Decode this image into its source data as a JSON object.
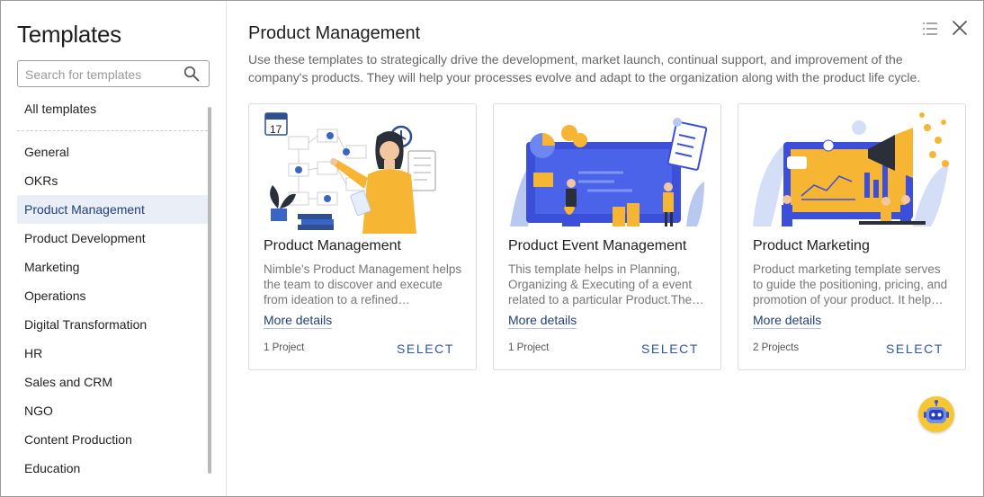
{
  "sidebar": {
    "title": "Templates",
    "search_placeholder": "Search for templates",
    "all_templates": "All templates",
    "items": [
      {
        "label": "General",
        "active": false
      },
      {
        "label": "OKRs",
        "active": false
      },
      {
        "label": "Product Management",
        "active": true
      },
      {
        "label": "Product Development",
        "active": false
      },
      {
        "label": "Marketing",
        "active": false
      },
      {
        "label": "Operations",
        "active": false
      },
      {
        "label": "Digital Transformation",
        "active": false
      },
      {
        "label": "HR",
        "active": false
      },
      {
        "label": "Sales and CRM",
        "active": false
      },
      {
        "label": "NGO",
        "active": false
      },
      {
        "label": "Content Production",
        "active": false
      },
      {
        "label": "Education",
        "active": false
      }
    ]
  },
  "main": {
    "title": "Product Management",
    "description": "Use these templates to strategically drive the development, market launch, continual support, and improvement of the company's products. They will help your processes evolve and adapt to the organization along with the product life cycle.",
    "cards": [
      {
        "title": "Product Management",
        "description": "Nimble's Product Management helps the team to discover and execute from ideation to a refined…",
        "more": "More details",
        "count": "1 Project",
        "select": "SELECT"
      },
      {
        "title": "Product Event Management",
        "description": "This template helps in Planning, Organizing & Executing of a event related to a particular Product.The…",
        "more": "More details",
        "count": "1 Project",
        "select": "SELECT"
      },
      {
        "title": "Product Marketing",
        "description": "Product marketing template serves to guide the positioning, pricing, and promotion of your product. It help…",
        "more": "More details",
        "count": "2 Projects",
        "select": "SELECT"
      }
    ]
  },
  "icons": {
    "search": "search-icon",
    "list": "list-view-icon",
    "close": "close-icon",
    "assistant": "robot-assistant-icon"
  },
  "colors": {
    "accent": "#2e54a7",
    "active_bg": "#e9eef7",
    "assistant_bg": "#f6c731"
  }
}
